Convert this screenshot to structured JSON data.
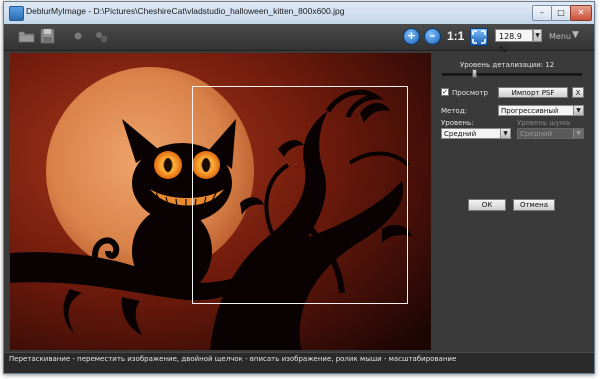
{
  "window": {
    "title": "DeblurMyImage - D:\\Pictures\\CheshireCat\\vladstudio_halloween_kitten_800x600.jpg",
    "minimize_icon": "minimize-icon",
    "maximize_icon": "maximize-icon",
    "close_icon": "close-icon"
  },
  "toolbar": {
    "icons": [
      "open-folder-icon",
      "save-icon",
      "record-icon",
      "effects-icon",
      "zoom-in-icon",
      "zoom-out-icon",
      "fit-to-window-icon"
    ],
    "actual_size_label": "1:1",
    "zoom_value": "128.9 %",
    "menu_label": "Menu"
  },
  "panel": {
    "detail_label": "Уровень детализации: 12",
    "detail_slider_fraction": 0.23,
    "preview_label": "Просмотр",
    "preview_checked": true,
    "import_psf_label": "Импорт PSF",
    "import_x_label": "X",
    "method_label": "Метод:",
    "method_value": "Прогрессивный",
    "level_label": "Уровень:",
    "level_value": "Средний",
    "noise_label": "Уровень шума:",
    "noise_value": "Средний",
    "ok_label": "ОК",
    "cancel_label": "Отмена"
  },
  "status": {
    "hint": "Перетаскивание - переместить изображение, двойной щелчок - вписать изображение, ролик мыши - масштабирование"
  },
  "colors": {
    "moon": "#d9824a",
    "background_dark": "#3a0e08",
    "selection": "#f2f2f2",
    "ui_bg": "#3a3a3a"
  }
}
